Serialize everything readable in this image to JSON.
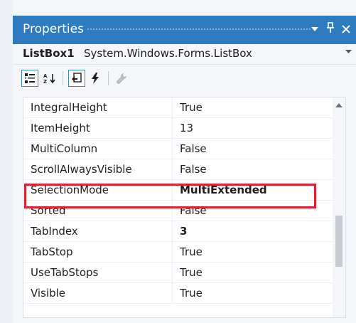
{
  "window": {
    "title": "Properties",
    "dropdown_icon": "▾",
    "pin_icon": "↕",
    "close_icon": "✕"
  },
  "object_selector": {
    "name": "ListBox1",
    "type": "System.Windows.Forms.ListBox",
    "dropdown_icon": "▾"
  },
  "toolbar": {
    "buttons": [
      {
        "name": "categorized-icon",
        "active": true
      },
      {
        "name": "alphabetical-icon",
        "active": false
      },
      {
        "name": "properties-icon",
        "active": true
      },
      {
        "name": "events-icon",
        "active": false
      },
      {
        "name": "property-pages-icon",
        "active": false
      }
    ]
  },
  "properties": [
    {
      "name": "IntegralHeight",
      "value": "True"
    },
    {
      "name": "ItemHeight",
      "value": "13"
    },
    {
      "name": "MultiColumn",
      "value": "False"
    },
    {
      "name": "ScrollAlwaysVisible",
      "value": "False"
    },
    {
      "name": "SelectionMode",
      "value": "MultiExtended",
      "bold": true,
      "highlighted": true
    },
    {
      "name": "Sorted",
      "value": "False"
    },
    {
      "name": "TabIndex",
      "value": "3",
      "bold": true
    },
    {
      "name": "TabStop",
      "value": "True"
    },
    {
      "name": "UseTabStops",
      "value": "True"
    },
    {
      "name": "Visible",
      "value": "True"
    }
  ],
  "colors": {
    "title_bar": "#2e7bbf",
    "highlight_box": "#e02030"
  }
}
